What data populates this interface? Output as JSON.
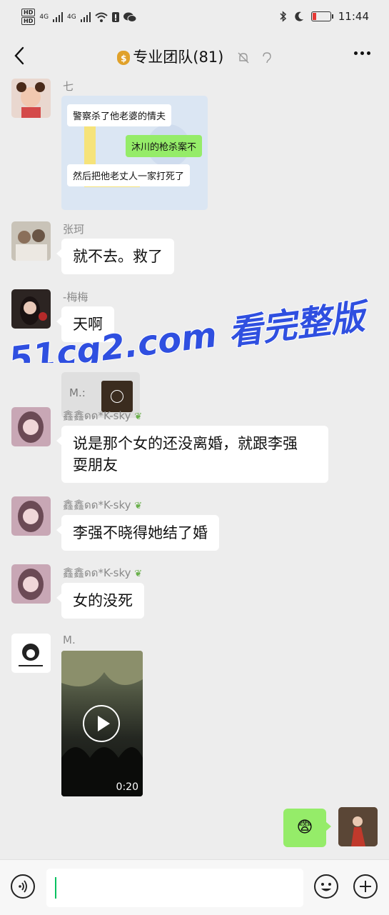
{
  "status_bar": {
    "left_label_1": "HD",
    "left_label_2": "HD",
    "net_1": "4G",
    "net_2": "4G",
    "time": "11:44"
  },
  "header": {
    "title": "专业团队(81)",
    "bag_glyph": "$",
    "back_icon": "chevron-left-icon",
    "more_icon": "more-icon"
  },
  "messages": [
    {
      "sender": "七",
      "kind": "image",
      "image_lines": [
        "警察杀了他老婆的情夫",
        "沐川的枪杀案不",
        "然后把他老丈人一家打死了"
      ]
    },
    {
      "sender": "张珂",
      "kind": "text",
      "text": "就不去。救了"
    },
    {
      "sender": "-梅梅",
      "kind": "text",
      "text": "天啊",
      "quote_label": "M.:"
    },
    {
      "sender": "鑫鑫ดด*K-sky",
      "kind": "text",
      "text_lines": [
        "说是那个女的还没离婚，就跟李强",
        "耍朋友"
      ]
    },
    {
      "sender": "鑫鑫ดด*K-sky",
      "kind": "text",
      "text": "李强不晓得她结了婚"
    },
    {
      "sender": "鑫鑫ดด*K-sky",
      "kind": "text",
      "text": "女的没死"
    },
    {
      "sender": "M.",
      "kind": "video",
      "duration": "0:20"
    }
  ],
  "self_message": {
    "emoji": "😨"
  },
  "watermark": {
    "text": "51cg2.com 看完整版"
  },
  "composer": {
    "voice_icon": "voice-icon",
    "emoji_icon": "emoji-icon",
    "plus_icon": "plus-icon",
    "input_value": ""
  },
  "colors": {
    "bubble_self": "#95ec69",
    "background": "#ededed",
    "watermark": "#2f4fe0"
  }
}
